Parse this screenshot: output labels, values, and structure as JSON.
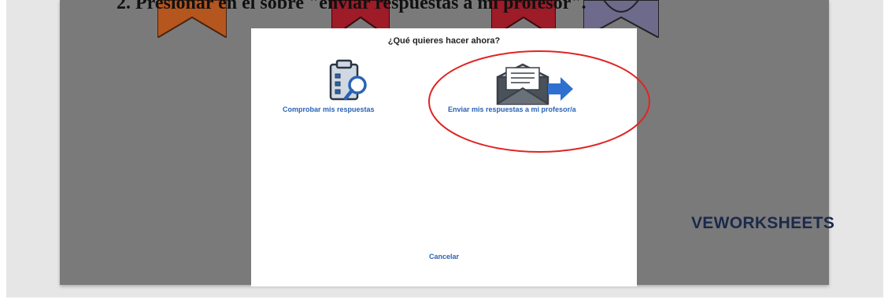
{
  "instruction": {
    "text": "2. Presionar en el sobre \"enviar respuestas a mi profesor\"."
  },
  "worksheet": {
    "brand_text": "VEWORKSHEETS"
  },
  "dialog": {
    "title": "¿Qué quieres hacer ahora?",
    "options": [
      {
        "label": "Comprobar mis respuestas",
        "icon": "clipboard-magnifier-icon"
      },
      {
        "label": "Enviar mis respuestas a mi profesor/a",
        "icon": "envelope-send-icon"
      }
    ],
    "cancel_label": "Cancelar"
  },
  "colors": {
    "link": "#2a63b5",
    "annotation": "#e02424",
    "overlay": "#7a7a7a",
    "ribbon_orange": "#b5561f",
    "ribbon_red": "#9e1b28",
    "ribbon_purple": "#6e6a8c"
  }
}
